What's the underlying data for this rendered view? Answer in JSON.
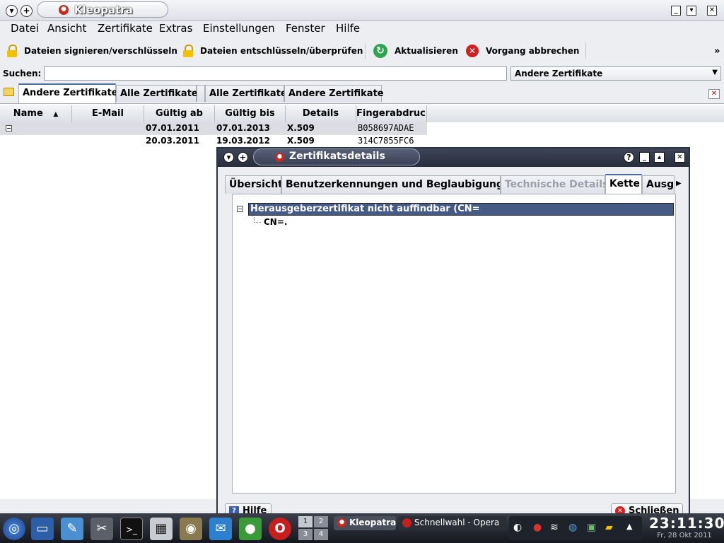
{
  "window": {
    "title": "Kleopatra"
  },
  "menu": [
    "Datei",
    "Ansicht",
    "Zertifikate",
    "Extras",
    "Einstellungen",
    "Fenster",
    "Hilfe"
  ],
  "toolbar": {
    "sign": "Dateien signieren/verschlüsseln",
    "decrypt": "Dateien entschlüsseln/überprüfen",
    "refresh": "Aktualisieren",
    "cancel": "Vorgang abbrechen",
    "more": "»"
  },
  "search": {
    "label": "Suchen:",
    "value": "",
    "filter": "Andere Zertifikate"
  },
  "tabs": [
    "Andere Zertifikate",
    "Alle Zertifikate",
    "Alle Zertifikate",
    "Andere Zertifikate"
  ],
  "table": {
    "columns": [
      "Name",
      "E-Mail",
      "Gültig ab",
      "Gültig bis",
      "Details",
      "Fingerabdruck"
    ],
    "rows": [
      {
        "valid_from": "07.01.2011",
        "valid_to": "07.01.2013",
        "details": "X.509",
        "fingerprint": "B058697ADAE"
      },
      {
        "valid_from": "20.03.2011",
        "valid_to": "19.03.2012",
        "details": "X.509",
        "fingerprint": "314C7855FC6"
      }
    ]
  },
  "dialog": {
    "title": "Zertifikatsdetails",
    "tabs": [
      "Übersicht",
      "Benutzerkennungen und Beglaubigungen",
      "Technische Details",
      "Kette",
      "Ausg"
    ],
    "tree_root": "Herausgeberzertifikat nicht auffindbar (CN=",
    "tree_child": "CN=.",
    "help_button": "Hilfe",
    "close_button": "Schließen"
  },
  "taskbar": {
    "tasks": [
      "Kleopatra",
      "Schnellwahl - Opera"
    ],
    "pager": [
      "1",
      "2",
      "3",
      "4"
    ],
    "time": "23:11:30",
    "date": "Fr, 28 Okt 2011"
  }
}
